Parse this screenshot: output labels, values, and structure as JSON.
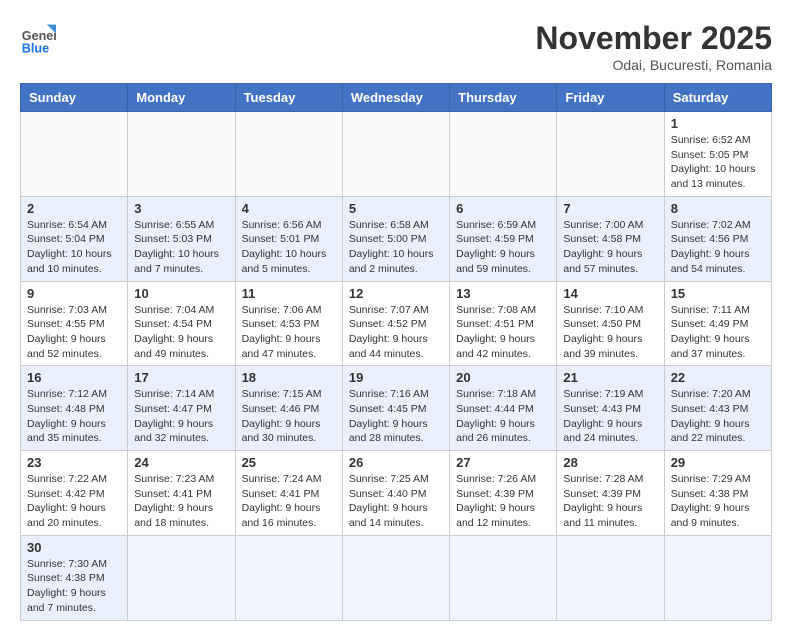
{
  "header": {
    "logo_general": "General",
    "logo_blue": "Blue",
    "month_year": "November 2025",
    "location": "Odai, Bucuresti, Romania"
  },
  "weekdays": [
    "Sunday",
    "Monday",
    "Tuesday",
    "Wednesday",
    "Thursday",
    "Friday",
    "Saturday"
  ],
  "weeks": [
    [
      {
        "day": "",
        "info": ""
      },
      {
        "day": "",
        "info": ""
      },
      {
        "day": "",
        "info": ""
      },
      {
        "day": "",
        "info": ""
      },
      {
        "day": "",
        "info": ""
      },
      {
        "day": "",
        "info": ""
      },
      {
        "day": "1",
        "info": "Sunrise: 6:52 AM\nSunset: 5:05 PM\nDaylight: 10 hours\nand 13 minutes."
      }
    ],
    [
      {
        "day": "2",
        "info": "Sunrise: 6:54 AM\nSunset: 5:04 PM\nDaylight: 10 hours\nand 10 minutes."
      },
      {
        "day": "3",
        "info": "Sunrise: 6:55 AM\nSunset: 5:03 PM\nDaylight: 10 hours\nand 7 minutes."
      },
      {
        "day": "4",
        "info": "Sunrise: 6:56 AM\nSunset: 5:01 PM\nDaylight: 10 hours\nand 5 minutes."
      },
      {
        "day": "5",
        "info": "Sunrise: 6:58 AM\nSunset: 5:00 PM\nDaylight: 10 hours\nand 2 minutes."
      },
      {
        "day": "6",
        "info": "Sunrise: 6:59 AM\nSunset: 4:59 PM\nDaylight: 9 hours\nand 59 minutes."
      },
      {
        "day": "7",
        "info": "Sunrise: 7:00 AM\nSunset: 4:58 PM\nDaylight: 9 hours\nand 57 minutes."
      },
      {
        "day": "8",
        "info": "Sunrise: 7:02 AM\nSunset: 4:56 PM\nDaylight: 9 hours\nand 54 minutes."
      }
    ],
    [
      {
        "day": "9",
        "info": "Sunrise: 7:03 AM\nSunset: 4:55 PM\nDaylight: 9 hours\nand 52 minutes."
      },
      {
        "day": "10",
        "info": "Sunrise: 7:04 AM\nSunset: 4:54 PM\nDaylight: 9 hours\nand 49 minutes."
      },
      {
        "day": "11",
        "info": "Sunrise: 7:06 AM\nSunset: 4:53 PM\nDaylight: 9 hours\nand 47 minutes."
      },
      {
        "day": "12",
        "info": "Sunrise: 7:07 AM\nSunset: 4:52 PM\nDaylight: 9 hours\nand 44 minutes."
      },
      {
        "day": "13",
        "info": "Sunrise: 7:08 AM\nSunset: 4:51 PM\nDaylight: 9 hours\nand 42 minutes."
      },
      {
        "day": "14",
        "info": "Sunrise: 7:10 AM\nSunset: 4:50 PM\nDaylight: 9 hours\nand 39 minutes."
      },
      {
        "day": "15",
        "info": "Sunrise: 7:11 AM\nSunset: 4:49 PM\nDaylight: 9 hours\nand 37 minutes."
      }
    ],
    [
      {
        "day": "16",
        "info": "Sunrise: 7:12 AM\nSunset: 4:48 PM\nDaylight: 9 hours\nand 35 minutes."
      },
      {
        "day": "17",
        "info": "Sunrise: 7:14 AM\nSunset: 4:47 PM\nDaylight: 9 hours\nand 32 minutes."
      },
      {
        "day": "18",
        "info": "Sunrise: 7:15 AM\nSunset: 4:46 PM\nDaylight: 9 hours\nand 30 minutes."
      },
      {
        "day": "19",
        "info": "Sunrise: 7:16 AM\nSunset: 4:45 PM\nDaylight: 9 hours\nand 28 minutes."
      },
      {
        "day": "20",
        "info": "Sunrise: 7:18 AM\nSunset: 4:44 PM\nDaylight: 9 hours\nand 26 minutes."
      },
      {
        "day": "21",
        "info": "Sunrise: 7:19 AM\nSunset: 4:43 PM\nDaylight: 9 hours\nand 24 minutes."
      },
      {
        "day": "22",
        "info": "Sunrise: 7:20 AM\nSunset: 4:43 PM\nDaylight: 9 hours\nand 22 minutes."
      }
    ],
    [
      {
        "day": "23",
        "info": "Sunrise: 7:22 AM\nSunset: 4:42 PM\nDaylight: 9 hours\nand 20 minutes."
      },
      {
        "day": "24",
        "info": "Sunrise: 7:23 AM\nSunset: 4:41 PM\nDaylight: 9 hours\nand 18 minutes."
      },
      {
        "day": "25",
        "info": "Sunrise: 7:24 AM\nSunset: 4:41 PM\nDaylight: 9 hours\nand 16 minutes."
      },
      {
        "day": "26",
        "info": "Sunrise: 7:25 AM\nSunset: 4:40 PM\nDaylight: 9 hours\nand 14 minutes."
      },
      {
        "day": "27",
        "info": "Sunrise: 7:26 AM\nSunset: 4:39 PM\nDaylight: 9 hours\nand 12 minutes."
      },
      {
        "day": "28",
        "info": "Sunrise: 7:28 AM\nSunset: 4:39 PM\nDaylight: 9 hours\nand 11 minutes."
      },
      {
        "day": "29",
        "info": "Sunrise: 7:29 AM\nSunset: 4:38 PM\nDaylight: 9 hours\nand 9 minutes."
      }
    ],
    [
      {
        "day": "30",
        "info": "Sunrise: 7:30 AM\nSunset: 4:38 PM\nDaylight: 9 hours\nand 7 minutes."
      },
      {
        "day": "",
        "info": ""
      },
      {
        "day": "",
        "info": ""
      },
      {
        "day": "",
        "info": ""
      },
      {
        "day": "",
        "info": ""
      },
      {
        "day": "",
        "info": ""
      },
      {
        "day": "",
        "info": ""
      }
    ]
  ]
}
